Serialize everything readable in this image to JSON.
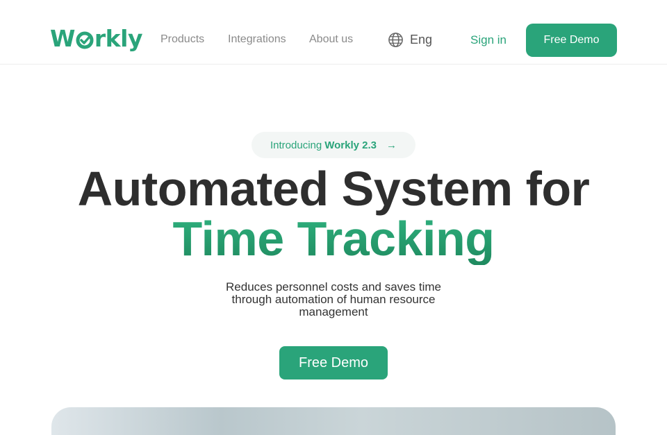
{
  "brand": {
    "name_before": "W",
    "name_after": "rkly",
    "color": "#2aa47a"
  },
  "nav": {
    "products": "Products",
    "integrations": "Integrations",
    "about": "About us"
  },
  "language": {
    "label": "Eng",
    "icon": "globe-icon"
  },
  "auth": {
    "signin": "Sign in",
    "header_cta": "Free Demo"
  },
  "hero": {
    "badge_prefix": "Introducing",
    "badge_product": "Workly 2.3",
    "badge_arrow": "→",
    "title_line1": "Automated System for",
    "title_line2": "Time Tracking",
    "subtitle_line1": "Reduces personnel costs and saves time",
    "subtitle_line2": "through automation of human resource",
    "subtitle_line3": "management",
    "cta": "Free Demo"
  },
  "colors": {
    "accent": "#2aa47a",
    "heading": "#2e2e2e",
    "nav_text": "#8a8a8a"
  }
}
